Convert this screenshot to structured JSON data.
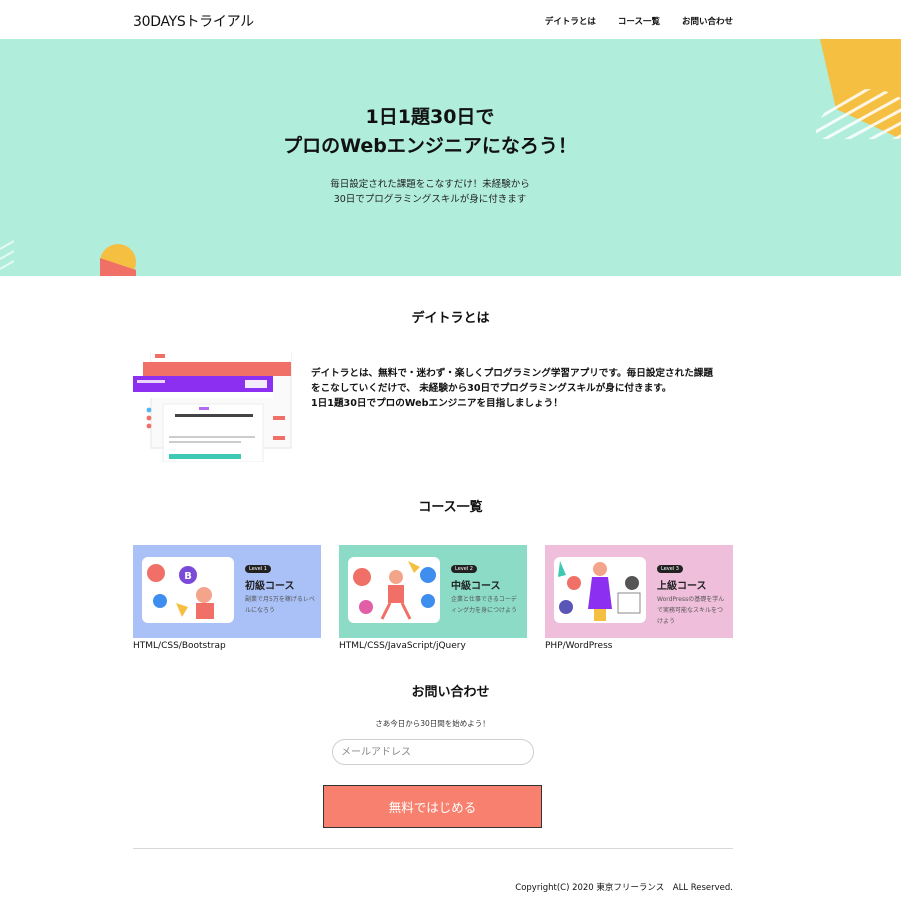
{
  "header": {
    "logo": "30DAYSトライアル",
    "nav": [
      "デイトラとは",
      "コース一覧",
      "お問い合わせ"
    ]
  },
  "hero": {
    "title_line1": "1日1題30日で",
    "title_line2": "プロのWebエンジニアになろう！",
    "sub_line1": "毎日設定された課題をこなすだけ！未経験から",
    "sub_line2": "30日でプログラミングスキルが身に付きます"
  },
  "about": {
    "title": "デイトラとは",
    "line1": "デイトラとは、無料で・迷わず・楽しくプログラミング学習アプリです。毎日設定された課題",
    "line2": "をこなしていくだけで、 未経験から30日でプログラミングスキルが身に付きます。",
    "line3": "1日1題30日でプロのWebエンジニアを目指しましょう！"
  },
  "courses": {
    "title": "コース一覧",
    "items": [
      {
        "level": "Level 1",
        "name": "初級コース",
        "desc": "副業で月5万を稼げるレベルになろう",
        "label": "HTML/CSS/Bootstrap",
        "bg": "#a9c1f7"
      },
      {
        "level": "Level 2",
        "name": "中級コース",
        "desc": "企業と仕事できるコーディング力を身につけよう",
        "label": "HTML/CSS/JavaScript/jQuery",
        "bg": "#8bdbc6"
      },
      {
        "level": "Level 3",
        "name": "上級コース",
        "desc": "WordPressの基礎を学んで実務可能なスキルをつけよう",
        "label": "PHP/WordPress",
        "bg": "#efbedb"
      }
    ]
  },
  "contact": {
    "title": "お問い合わせ",
    "lead": "さあ今日から30日間を始めよう！",
    "email_placeholder": "メールアドレス",
    "cta_label": "無料ではじめる"
  },
  "footer": {
    "copyright": "Copyright(C) 2020 東京フリーランス　ALL Reserved."
  },
  "colors": {
    "hero_bg": "#b0edda",
    "cta_bg": "#f7806e",
    "accent_yellow": "#f5bf42",
    "accent_red": "#f07068"
  }
}
